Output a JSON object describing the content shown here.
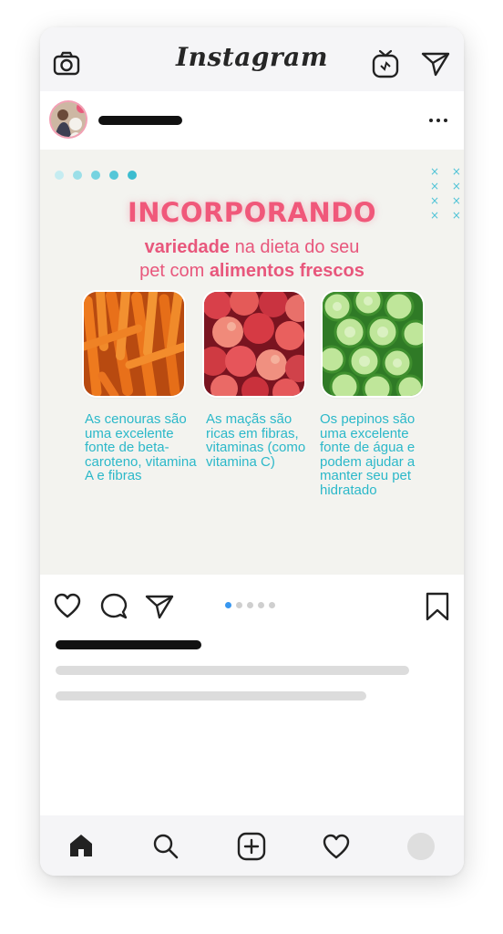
{
  "header": {
    "brand": "Instagram",
    "left_icon": "camera-icon",
    "right_icons": [
      "igtv-icon",
      "direct-message-icon"
    ]
  },
  "post": {
    "more_icon": "more-options-icon",
    "carousel": {
      "title": "INCORPORANDO",
      "subtitle": {
        "part1": "variedade",
        "part2": " na dieta do seu",
        "part3": "pet com ",
        "part4": "alimentos frescos"
      },
      "items": [
        {
          "image": "carrots-photo",
          "caption": "As cenouras são uma excelente fonte de beta-caroteno, vitamina A e fibras"
        },
        {
          "image": "apples-photo",
          "caption": "As maçãs são ricas em fibras, vitaminas (como vitamina C)"
        },
        {
          "image": "cucumbers-photo",
          "caption": "Os pepinos são uma excelente fonte de água e podem ajudar a manter seu pet hidratado"
        }
      ]
    },
    "actions": [
      "heart-icon",
      "comment-icon",
      "share-icon",
      "bookmark-icon"
    ],
    "page_indicator": {
      "count": 5,
      "active": 1
    }
  },
  "bottom_nav": [
    "home-icon",
    "search-icon",
    "new-post-icon",
    "activity-heart-icon",
    "profile-avatar"
  ],
  "colors": {
    "accent_pink": "#f0587a",
    "caption_teal": "#2bb8c9",
    "indicator_blue": "#3897f0",
    "card_bg": "#f3f3ef"
  }
}
